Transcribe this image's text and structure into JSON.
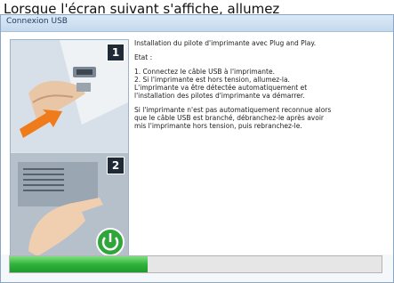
{
  "caption": "Lorsque l'écran suivant s'affiche, allumez",
  "window": {
    "title": "Connexion USB"
  },
  "steps": [
    {
      "number": "1"
    },
    {
      "number": "2"
    }
  ],
  "instructions": {
    "intro": "Installation du pilote d'imprimante avec Plug and Play.",
    "status_label": "Etat :",
    "step1": "1. Connectez le câble USB à l'imprimante.",
    "step2": "2. Si l'imprimante est hors tension, allumez-la.",
    "detect_line1": "L'imprimante va être détectée automatiquement et",
    "detect_line2": "l'installation des pilotes d'imprimante va démarrer.",
    "note_line1": "Si l'imprimante n'est pas automatiquement reconnue alors",
    "note_line2": "que le câble USB est branché, débranchez-le après avoir",
    "note_line3": "mis l'imprimante hors tension, puis rebranchez-le."
  },
  "progress": {
    "fraction": 0.37,
    "color": "#2fb23a"
  }
}
